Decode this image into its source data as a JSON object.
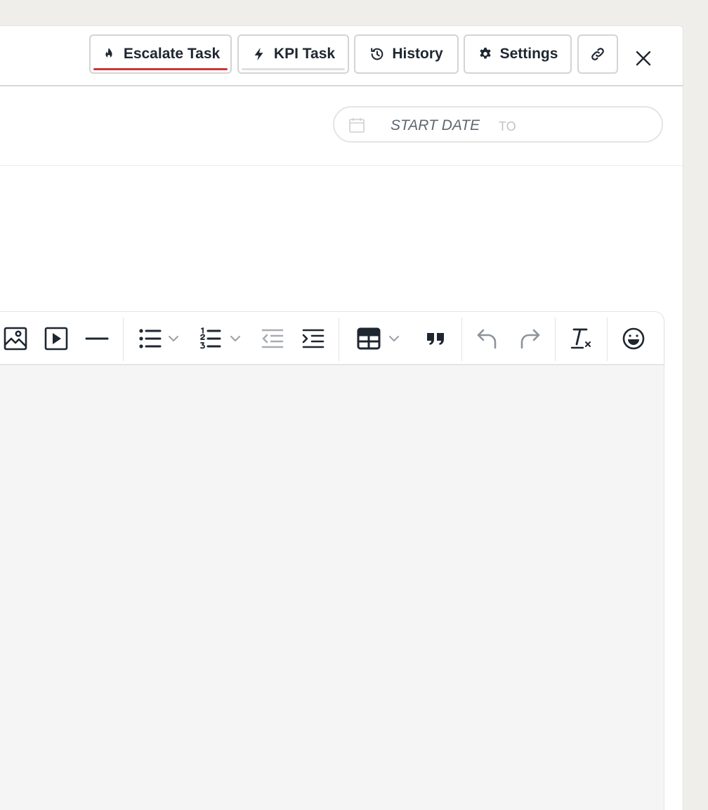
{
  "header": {
    "buttons": {
      "escalate": {
        "label": "Escalate Task",
        "icon": "flame-icon",
        "underline_color": "#c9363c"
      },
      "kpi": {
        "label": "KPI Task",
        "icon": "bolt-icon",
        "underline_color": "#e0e0e0"
      },
      "history": {
        "label": "History",
        "icon": "history-icon"
      },
      "settings": {
        "label": "Settings",
        "icon": "gear-icon"
      },
      "link": {
        "icon": "link-icon"
      },
      "close": {
        "icon": "close-icon"
      }
    }
  },
  "date_range": {
    "start_placeholder": "START DATE",
    "separator": "TO",
    "icon": "calendar-icon"
  },
  "toolbar": {
    "items": [
      "image-icon",
      "video-icon",
      "horizontal-rule-icon",
      "bullet-list-icon",
      "numbered-list-icon",
      "outdent-icon",
      "indent-icon",
      "table-icon",
      "blockquote-icon",
      "undo-icon",
      "redo-icon",
      "clear-format-icon",
      "emoji-icon"
    ]
  },
  "colors": {
    "text": "#1e2630",
    "border": "#d4d4d4",
    "editor_bg": "#f5f5f5",
    "page_bg": "#efeeeb"
  }
}
